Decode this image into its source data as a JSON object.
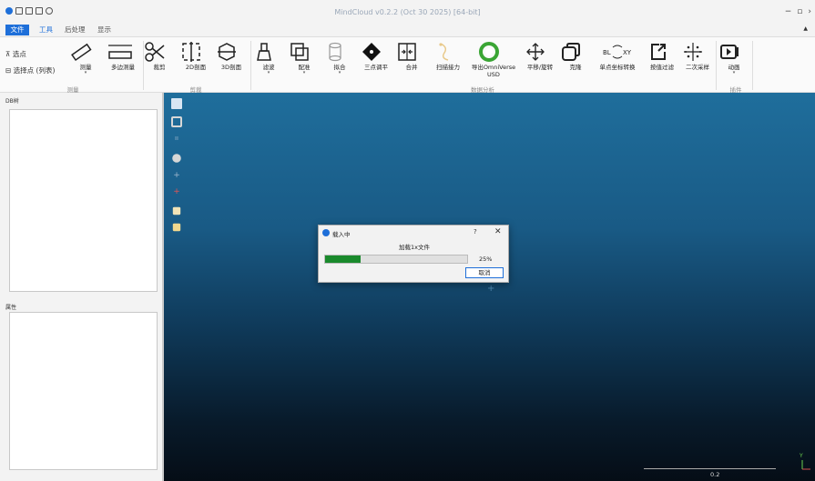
{
  "window": {
    "title": "MindCloud v0.2.2 (Oct 30 2025) [64-bit]",
    "controls": [
      "−",
      "▫",
      "›"
    ]
  },
  "menu_tabs": [
    {
      "label": "文件"
    },
    {
      "label": "工具"
    },
    {
      "label": "后处理"
    },
    {
      "label": "显示"
    }
  ],
  "ribbon": {
    "select_point": "选点",
    "select_points_list": "选择点 (列表)",
    "tools": [
      {
        "label": "测量",
        "has_dropdown": true
      },
      {
        "label": "多边测量",
        "has_dropdown": false
      },
      {
        "label": "裁剪",
        "has_dropdown": false
      },
      {
        "label": "2D剖面",
        "has_dropdown": false
      },
      {
        "label": "3D剖面",
        "has_dropdown": false
      },
      {
        "label": "滤波",
        "has_dropdown": true
      },
      {
        "label": "配准",
        "has_dropdown": true
      },
      {
        "label": "拟合",
        "has_dropdown": true
      },
      {
        "label": "三点调平",
        "has_dropdown": false
      },
      {
        "label": "合并",
        "has_dropdown": false
      },
      {
        "label": "扫描接力",
        "has_dropdown": false
      },
      {
        "label": "导出OmniVerse USD",
        "has_dropdown": false
      },
      {
        "label": "平移/旋转",
        "has_dropdown": false
      },
      {
        "label": "克隆",
        "has_dropdown": false
      },
      {
        "label": "单点坐标转换",
        "has_dropdown": false
      },
      {
        "label": "按值过滤",
        "has_dropdown": false
      },
      {
        "label": "二次采样",
        "has_dropdown": false
      },
      {
        "label": "动画",
        "has_dropdown": true
      }
    ],
    "groups": {
      "measure": "测量",
      "clip": "剪裁",
      "analysis": "数据分析",
      "plugin": "插件"
    },
    "dropdown_glyph": "▾"
  },
  "panels": {
    "db_tree": "DB树",
    "properties": "属性"
  },
  "dialog": {
    "title": "载入中",
    "help": "?",
    "close": "✕",
    "message": "加载1x文件",
    "progress": 0.25,
    "progress_label": "25%",
    "cancel": "取消"
  },
  "viewport": {
    "scale_label": "0.2",
    "axis_y": "Y",
    "crosshair": "+"
  },
  "colors": {
    "accent": "#1e6fd9",
    "progress": "#1a8a2c"
  }
}
